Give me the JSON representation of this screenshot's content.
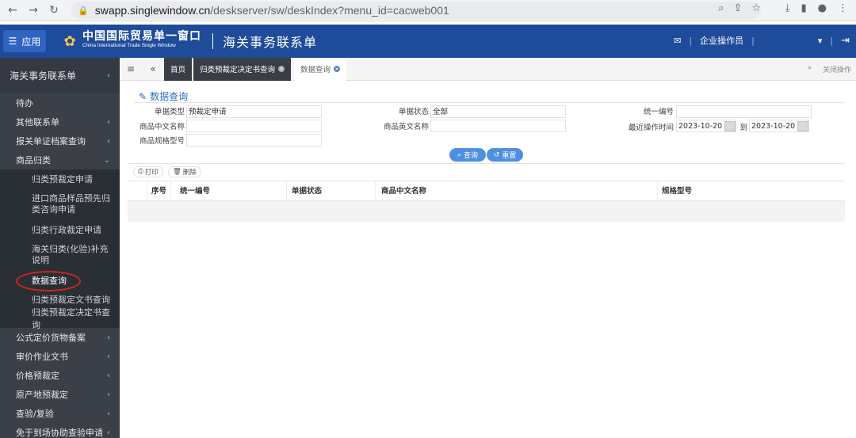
{
  "browser": {
    "url_host": "swapp.singlewindow.cn",
    "url_path": "/deskserver/sw/deskIndex?menu_id=cacweb001"
  },
  "header": {
    "menu_label": "应用",
    "logo_cn": "中国国际贸易单一窗口",
    "logo_en": "China International Trade Single Window",
    "title": "海关事务联系单",
    "user_label": "企业操作员"
  },
  "sidebar": {
    "head": "海关事务联系单",
    "items": [
      {
        "label": "待办"
      },
      {
        "label": "其他联系单"
      },
      {
        "label": "报关单证档案查询"
      },
      {
        "label": "商品归类"
      }
    ],
    "sub_items": [
      {
        "label": "归类预裁定申请"
      },
      {
        "label": "进口商品样品预先归类咨询申请"
      },
      {
        "label": "归类行政裁定申请"
      },
      {
        "label": "海关归类(化验)补充说明"
      },
      {
        "label": "数据查询"
      },
      {
        "label": "归类预裁定文书查询"
      },
      {
        "label": "归类预裁定决定书查询"
      }
    ],
    "bottom_items": [
      {
        "label": "公式定价货物备案"
      },
      {
        "label": "审价作业文书"
      },
      {
        "label": "价格预裁定"
      },
      {
        "label": "原产地预裁定"
      },
      {
        "label": "查验/复验"
      },
      {
        "label": "免于到场协助查验申请"
      }
    ]
  },
  "tabs": [
    {
      "label": "首页"
    },
    {
      "label": "归类预裁定决定书查询"
    },
    {
      "label": "数据查询"
    }
  ],
  "tabbar_right": "关闭操作",
  "form": {
    "panel_title": "数据查询",
    "doc_type_label": "单据类型",
    "doc_type_value": "预裁定申请",
    "doc_status_label": "单据状态",
    "doc_status_value": "全部",
    "unified_no_label": "统一编号",
    "cn_name_label": "商品中文名称",
    "en_name_label": "商品英文名称",
    "last_op_label": "最近操作时间",
    "date_from": "2023-10-20",
    "to_label": "到",
    "date_to": "2023-10-20",
    "spec_label": "商品规格型号",
    "search_btn": "查询",
    "reset_btn": "重置"
  },
  "toolbar": {
    "print": "打印",
    "delete": "删除"
  },
  "table": {
    "columns": [
      "序号",
      "统一编号",
      "单据状态",
      "商品中文名称",
      "规格型号"
    ]
  }
}
